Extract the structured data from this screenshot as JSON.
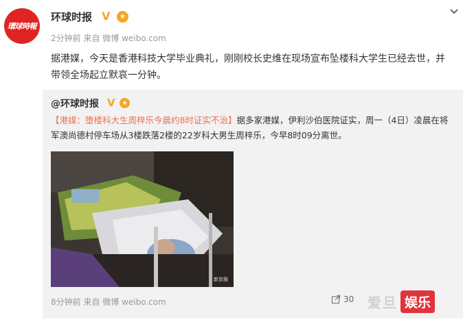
{
  "post": {
    "avatar_text": "環球時報",
    "username": "环球时报",
    "verified_mark": "V",
    "medal_mark": "★",
    "meta": "2分钟前 来自 微博 weibo.com",
    "text": "据港媒，今天是香港科技大学毕业典礼，刚刚校长史维在现场宣布坠楼科大学生已经去世，并带领全场起立默哀一分钟。"
  },
  "repost": {
    "username": "@环球时报",
    "verified_mark": "V",
    "medal_mark": "★",
    "text_link": "【港媒：堕楼科大生周梓乐今晨约8时证实不治】",
    "text_body": "据多家港媒，伊利沙伯医院证实，周一（4日）凌晨在将军澳尚德村停车场从3楼跌落2楼的22岁科大男生周梓乐，今早8时09分离世。",
    "photo_alt": "hospital bed photo",
    "photo_watermark": "新京报",
    "meta": "8分钟前 来自 微博 weibo.com",
    "repost_count": "30"
  },
  "watermark": {
    "left": "爱旦",
    "right": "娱乐"
  }
}
